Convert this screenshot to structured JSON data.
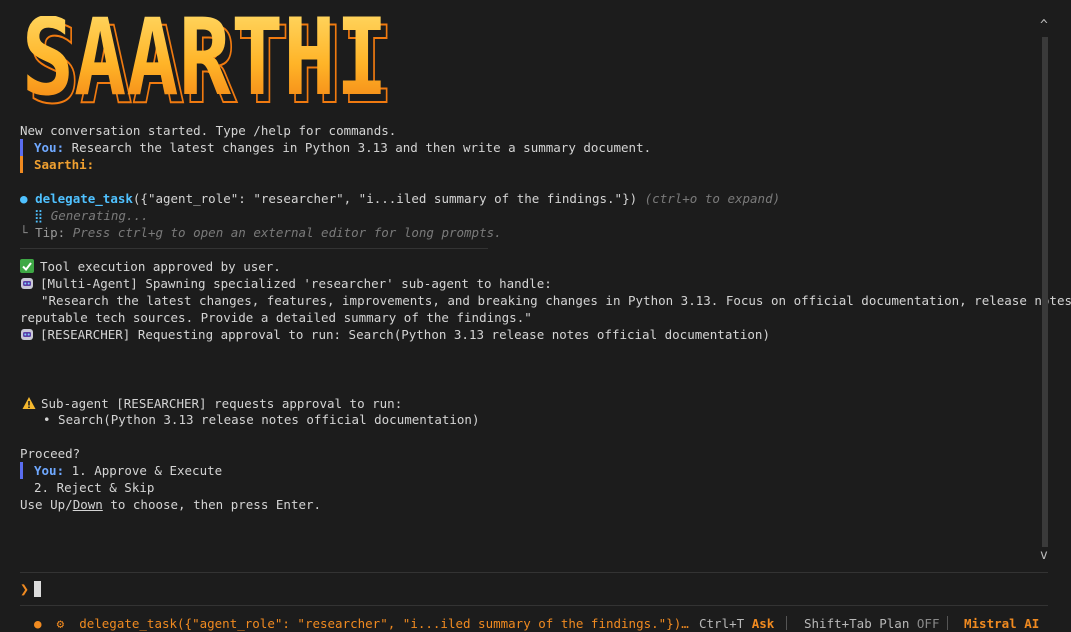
{
  "logo": {
    "text": "SAARTHI"
  },
  "conversation": {
    "start_message": "New conversation started. Type /help for commands.",
    "user_label": "You:",
    "user_message": "Research the latest changes in Python 3.13 and then write a summary document.",
    "assistant_label": "Saarthi:",
    "tool_call": {
      "name": "delegate_task",
      "args": "({\"agent_role\": \"researcher\", \"i...iled summary of the findings.\"})",
      "hint": "(ctrl+o to expand)"
    },
    "generating": "Generating...",
    "tip_label": "Tip:",
    "tip_text": "Press ctrl+g to open an external editor for long prompts.",
    "approved": "Tool execution approved by user.",
    "spawn": "[Multi-Agent] Spawning specialized 'researcher' sub-agent to handle:",
    "task_line1": "\"Research the latest changes, features, improvements, and breaking changes in Python 3.13. Focus on official documentation, release notes, and",
    "task_line2": "reputable tech sources. Provide a detailed summary of the findings.\"",
    "researcher_request": "[RESEARCHER] Requesting approval to run: Search(Python 3.13 release notes official documentation)",
    "approval_title": "Sub-agent [RESEARCHER] requests approval to run:",
    "approval_item": "• Search(Python 3.13 release notes official documentation)",
    "proceed": "Proceed?",
    "option1": "1. Approve & Execute",
    "option2": "2. Reject & Skip",
    "instruction_pre": "Use Up/",
    "instruction_down": "Down",
    "instruction_post": " to choose, then press Enter."
  },
  "scrollbar": {
    "up": "^",
    "down": "v"
  },
  "status_bar": {
    "bullet": "●",
    "gear": "⚙",
    "task": "delegate_task({\"agent_role\": \"researcher\", \"i...iled summary of the findings.\"})…",
    "ask_key": "Ctrl+T",
    "ask_label": "Ask",
    "plan_key": "Shift+Tab Plan",
    "plan_state": "OFF",
    "provider": "Mistral AI"
  },
  "colors": {
    "background": "#1c1c1c",
    "accent_orange": "#f08a20",
    "accent_blue": "#5a6df0",
    "tool_blue": "#4fc1ff"
  }
}
